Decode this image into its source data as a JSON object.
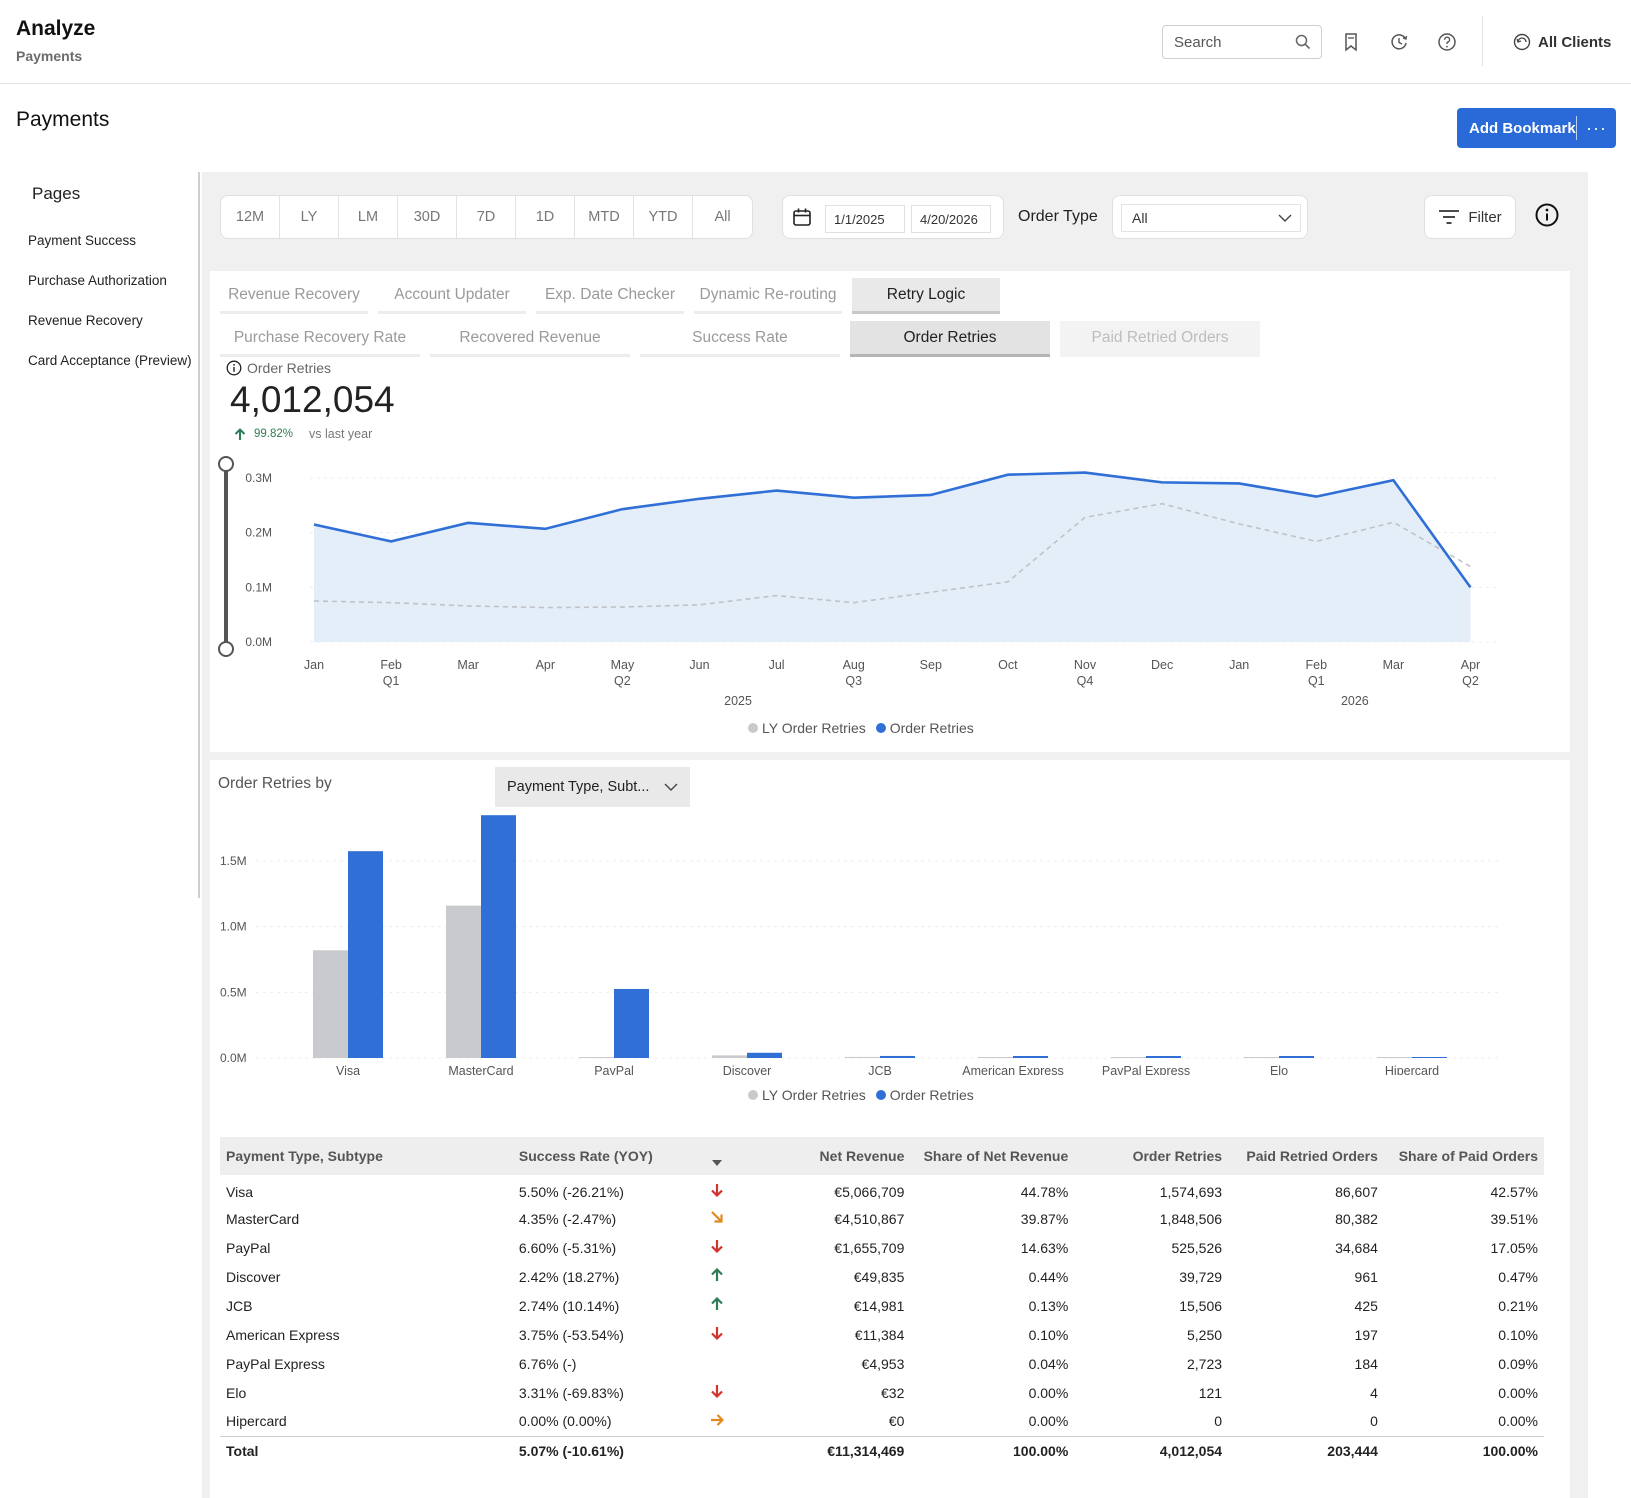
{
  "app": {
    "title": "Analyze",
    "subtitle": "Payments"
  },
  "topbar": {
    "search_placeholder": "Search",
    "clients_label": "All Clients"
  },
  "page": {
    "title": "Payments",
    "add_bookmark_label": "Add Bookmark",
    "more_label": "···"
  },
  "sidebar": {
    "title": "Pages",
    "items": [
      {
        "label": "Payment Success"
      },
      {
        "label": "Purchase Authorization"
      },
      {
        "label": "Revenue Recovery"
      },
      {
        "label": "Card Acceptance (Preview)"
      }
    ]
  },
  "controls": {
    "time_buttons": [
      "12M",
      "LY",
      "LM",
      "30D",
      "7D",
      "1D",
      "MTD",
      "YTD",
      "All"
    ],
    "date_start": "1/1/2025",
    "date_end": "4/20/2026",
    "order_type_label": "Order Type",
    "order_type_value": "All",
    "filter_label": "Filter"
  },
  "tabs_primary": [
    {
      "label": "Revenue Recovery",
      "active": false
    },
    {
      "label": "Account Updater",
      "active": false
    },
    {
      "label": "Exp. Date Checker",
      "active": false
    },
    {
      "label": "Dynamic Re-routing",
      "active": false
    },
    {
      "label": "Retry Logic",
      "active": true
    }
  ],
  "tabs_secondary": [
    {
      "label": "Purchase Recovery Rate",
      "state": "normal"
    },
    {
      "label": "Recovered Revenue",
      "state": "normal"
    },
    {
      "label": "Success Rate",
      "state": "normal"
    },
    {
      "label": "Order Retries",
      "state": "active"
    },
    {
      "label": "Paid Retried Orders",
      "state": "disabled"
    }
  ],
  "kpi": {
    "label": "Order Retries",
    "value": "4,012,054",
    "delta": "99.82%",
    "vs": "vs last year"
  },
  "colors": {
    "accent": "#2a6ad8",
    "series_blue": "#2f6fd6",
    "series_gray": "#c8cacd",
    "area_fill": "#e4eef9",
    "up": "#2e7d54",
    "down": "#d0342c",
    "neutral": "#e08a1e"
  },
  "breakdown": {
    "label": "Order Retries by",
    "dimension": "Payment Type, Subt..."
  },
  "chart_data": [
    {
      "type": "line",
      "x_ticks": [
        "Jan",
        "Feb",
        "Mar",
        "Apr",
        "May",
        "Jun",
        "Jul",
        "Aug",
        "Sep",
        "Oct",
        "Nov",
        "Dec",
        "Jan",
        "Feb",
        "Mar",
        "Apr"
      ],
      "quarter_ticks": [
        "",
        "Q1",
        "",
        "",
        "Q2",
        "",
        "",
        "Q3",
        "",
        "",
        "Q4",
        "",
        "",
        "Q1",
        "",
        "Q2"
      ],
      "year_ticks": [
        {
          "label": "2025",
          "at": "Jun"
        },
        {
          "label": "2026",
          "at": "Feb-Mar"
        }
      ],
      "y_ticks": [
        "0.0M",
        "0.1M",
        "0.2M",
        "0.3M"
      ],
      "ylim": [
        0,
        0.3
      ],
      "series": [
        {
          "name": "LY Order Retries",
          "values": [
            0.075,
            0.072,
            0.066,
            0.063,
            0.064,
            0.068,
            0.085,
            0.072,
            0.091,
            0.11,
            0.228,
            0.253,
            0.216,
            0.184,
            0.219,
            0.138
          ]
        },
        {
          "name": "Order Retries",
          "values": [
            0.215,
            0.184,
            0.218,
            0.207,
            0.243,
            0.262,
            0.277,
            0.264,
            0.269,
            0.306,
            0.31,
            0.292,
            0.29,
            0.266,
            0.296,
            0.1
          ]
        }
      ]
    },
    {
      "type": "bar",
      "categories": [
        "Visa",
        "MasterCard",
        "PayPal",
        "Discover",
        "JCB",
        "American Express",
        "PayPal Express",
        "Elo",
        "Hipercard"
      ],
      "y_ticks": [
        "0.0M",
        "0.5M",
        "1.0M",
        "1.5M"
      ],
      "ylim": [
        0,
        1.85
      ],
      "series": [
        {
          "name": "LY Order Retries",
          "values": [
            0.82,
            1.16,
            0.005,
            0.02,
            0.008,
            0.005,
            0.003,
            0.0005,
            0.0003
          ]
        },
        {
          "name": "Order Retries",
          "values": [
            1.574693,
            1.848506,
            0.525526,
            0.039729,
            0.015506,
            0.00525,
            0.002723,
            0.000121,
            0
          ]
        }
      ]
    }
  ],
  "table": {
    "headers": [
      "Payment Type, Subtype",
      "Success Rate (YOY)",
      "",
      "Net Revenue",
      "Share of Net Revenue",
      "Order Retries",
      "Paid Retried Orders",
      "Share of Paid Orders"
    ],
    "rows": [
      {
        "name": "Visa",
        "rate": "5.50% (-26.21%)",
        "trend": "down",
        "net": "€5,066,709",
        "share_net": "44.78%",
        "retries": "1,574,693",
        "paid": "86,607",
        "share_paid": "42.57%"
      },
      {
        "name": "MasterCard",
        "rate": "4.35% (-2.47%)",
        "trend": "down-right",
        "net": "€4,510,867",
        "share_net": "39.87%",
        "retries": "1,848,506",
        "paid": "80,382",
        "share_paid": "39.51%"
      },
      {
        "name": "PayPal",
        "rate": "6.60% (-5.31%)",
        "trend": "down",
        "net": "€1,655,709",
        "share_net": "14.63%",
        "retries": "525,526",
        "paid": "34,684",
        "share_paid": "17.05%"
      },
      {
        "name": "Discover",
        "rate": "2.42% (18.27%)",
        "trend": "up",
        "net": "€49,835",
        "share_net": "0.44%",
        "retries": "39,729",
        "paid": "961",
        "share_paid": "0.47%"
      },
      {
        "name": "JCB",
        "rate": "2.74% (10.14%)",
        "trend": "up",
        "net": "€14,981",
        "share_net": "0.13%",
        "retries": "15,506",
        "paid": "425",
        "share_paid": "0.21%"
      },
      {
        "name": "American Express",
        "rate": "3.75% (-53.54%)",
        "trend": "down",
        "net": "€11,384",
        "share_net": "0.10%",
        "retries": "5,250",
        "paid": "197",
        "share_paid": "0.10%"
      },
      {
        "name": "PayPal Express",
        "rate": "6.76% (-)",
        "trend": "none",
        "net": "€4,953",
        "share_net": "0.04%",
        "retries": "2,723",
        "paid": "184",
        "share_paid": "0.09%"
      },
      {
        "name": "Elo",
        "rate": "3.31% (-69.83%)",
        "trend": "down",
        "net": "€32",
        "share_net": "0.00%",
        "retries": "121",
        "paid": "4",
        "share_paid": "0.00%"
      },
      {
        "name": "Hipercard",
        "rate": "0.00% (0.00%)",
        "trend": "right",
        "net": "€0",
        "share_net": "0.00%",
        "retries": "0",
        "paid": "0",
        "share_paid": "0.00%"
      }
    ],
    "total": {
      "name": "Total",
      "rate": "5.07% (-10.61%)",
      "net": "€11,314,469",
      "share_net": "100.00%",
      "retries": "4,012,054",
      "paid": "203,444",
      "share_paid": "100.00%"
    }
  }
}
